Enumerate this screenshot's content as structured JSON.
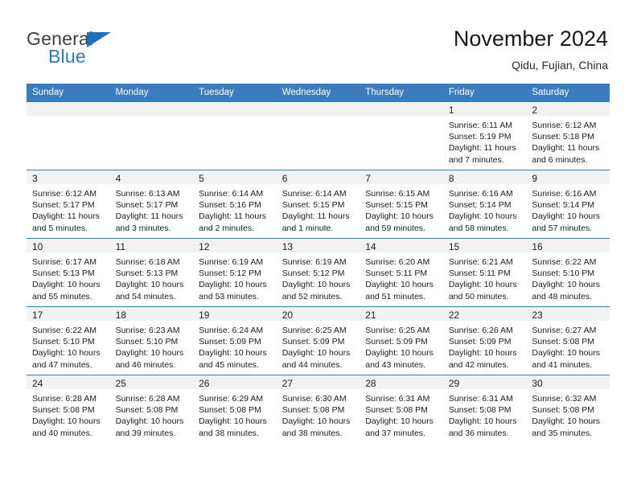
{
  "brand": {
    "name_part1": "General",
    "name_part2": "Blue",
    "logo_icon": "triangle-logo-icon"
  },
  "header": {
    "title": "November 2024",
    "subtitle": "Qidu, Fujian, China"
  },
  "calendar": {
    "accent_color": "#3a7cbe",
    "daynum_band_color": "#f2f2f2",
    "weekday_headers": [
      "Sunday",
      "Monday",
      "Tuesday",
      "Wednesday",
      "Thursday",
      "Friday",
      "Saturday"
    ],
    "labels": {
      "sunrise_prefix": "Sunrise:",
      "sunset_prefix": "Sunset:",
      "daylight_prefix": "Daylight:"
    },
    "weeks": [
      [
        {
          "day": "",
          "empty": true
        },
        {
          "day": "",
          "empty": true
        },
        {
          "day": "",
          "empty": true
        },
        {
          "day": "",
          "empty": true
        },
        {
          "day": "",
          "empty": true
        },
        {
          "day": "1",
          "sunrise": "Sunrise: 6:11 AM",
          "sunset": "Sunset: 5:19 PM",
          "daylight_line1": "Daylight: 11 hours",
          "daylight_line2": "and 7 minutes."
        },
        {
          "day": "2",
          "sunrise": "Sunrise: 6:12 AM",
          "sunset": "Sunset: 5:18 PM",
          "daylight_line1": "Daylight: 11 hours",
          "daylight_line2": "and 6 minutes."
        }
      ],
      [
        {
          "day": "3",
          "sunrise": "Sunrise: 6:12 AM",
          "sunset": "Sunset: 5:17 PM",
          "daylight_line1": "Daylight: 11 hours",
          "daylight_line2": "and 5 minutes."
        },
        {
          "day": "4",
          "sunrise": "Sunrise: 6:13 AM",
          "sunset": "Sunset: 5:17 PM",
          "daylight_line1": "Daylight: 11 hours",
          "daylight_line2": "and 3 minutes."
        },
        {
          "day": "5",
          "sunrise": "Sunrise: 6:14 AM",
          "sunset": "Sunset: 5:16 PM",
          "daylight_line1": "Daylight: 11 hours",
          "daylight_line2": "and 2 minutes."
        },
        {
          "day": "6",
          "sunrise": "Sunrise: 6:14 AM",
          "sunset": "Sunset: 5:15 PM",
          "daylight_line1": "Daylight: 11 hours",
          "daylight_line2": "and 1 minute."
        },
        {
          "day": "7",
          "sunrise": "Sunrise: 6:15 AM",
          "sunset": "Sunset: 5:15 PM",
          "daylight_line1": "Daylight: 10 hours",
          "daylight_line2": "and 59 minutes."
        },
        {
          "day": "8",
          "sunrise": "Sunrise: 6:16 AM",
          "sunset": "Sunset: 5:14 PM",
          "daylight_line1": "Daylight: 10 hours",
          "daylight_line2": "and 58 minutes."
        },
        {
          "day": "9",
          "sunrise": "Sunrise: 6:16 AM",
          "sunset": "Sunset: 5:14 PM",
          "daylight_line1": "Daylight: 10 hours",
          "daylight_line2": "and 57 minutes."
        }
      ],
      [
        {
          "day": "10",
          "sunrise": "Sunrise: 6:17 AM",
          "sunset": "Sunset: 5:13 PM",
          "daylight_line1": "Daylight: 10 hours",
          "daylight_line2": "and 55 minutes."
        },
        {
          "day": "11",
          "sunrise": "Sunrise: 6:18 AM",
          "sunset": "Sunset: 5:13 PM",
          "daylight_line1": "Daylight: 10 hours",
          "daylight_line2": "and 54 minutes."
        },
        {
          "day": "12",
          "sunrise": "Sunrise: 6:19 AM",
          "sunset": "Sunset: 5:12 PM",
          "daylight_line1": "Daylight: 10 hours",
          "daylight_line2": "and 53 minutes."
        },
        {
          "day": "13",
          "sunrise": "Sunrise: 6:19 AM",
          "sunset": "Sunset: 5:12 PM",
          "daylight_line1": "Daylight: 10 hours",
          "daylight_line2": "and 52 minutes."
        },
        {
          "day": "14",
          "sunrise": "Sunrise: 6:20 AM",
          "sunset": "Sunset: 5:11 PM",
          "daylight_line1": "Daylight: 10 hours",
          "daylight_line2": "and 51 minutes."
        },
        {
          "day": "15",
          "sunrise": "Sunrise: 6:21 AM",
          "sunset": "Sunset: 5:11 PM",
          "daylight_line1": "Daylight: 10 hours",
          "daylight_line2": "and 50 minutes."
        },
        {
          "day": "16",
          "sunrise": "Sunrise: 6:22 AM",
          "sunset": "Sunset: 5:10 PM",
          "daylight_line1": "Daylight: 10 hours",
          "daylight_line2": "and 48 minutes."
        }
      ],
      [
        {
          "day": "17",
          "sunrise": "Sunrise: 6:22 AM",
          "sunset": "Sunset: 5:10 PM",
          "daylight_line1": "Daylight: 10 hours",
          "daylight_line2": "and 47 minutes."
        },
        {
          "day": "18",
          "sunrise": "Sunrise: 6:23 AM",
          "sunset": "Sunset: 5:10 PM",
          "daylight_line1": "Daylight: 10 hours",
          "daylight_line2": "and 46 minutes."
        },
        {
          "day": "19",
          "sunrise": "Sunrise: 6:24 AM",
          "sunset": "Sunset: 5:09 PM",
          "daylight_line1": "Daylight: 10 hours",
          "daylight_line2": "and 45 minutes."
        },
        {
          "day": "20",
          "sunrise": "Sunrise: 6:25 AM",
          "sunset": "Sunset: 5:09 PM",
          "daylight_line1": "Daylight: 10 hours",
          "daylight_line2": "and 44 minutes."
        },
        {
          "day": "21",
          "sunrise": "Sunrise: 6:25 AM",
          "sunset": "Sunset: 5:09 PM",
          "daylight_line1": "Daylight: 10 hours",
          "daylight_line2": "and 43 minutes."
        },
        {
          "day": "22",
          "sunrise": "Sunrise: 6:26 AM",
          "sunset": "Sunset: 5:09 PM",
          "daylight_line1": "Daylight: 10 hours",
          "daylight_line2": "and 42 minutes."
        },
        {
          "day": "23",
          "sunrise": "Sunrise: 6:27 AM",
          "sunset": "Sunset: 5:08 PM",
          "daylight_line1": "Daylight: 10 hours",
          "daylight_line2": "and 41 minutes."
        }
      ],
      [
        {
          "day": "24",
          "sunrise": "Sunrise: 6:28 AM",
          "sunset": "Sunset: 5:08 PM",
          "daylight_line1": "Daylight: 10 hours",
          "daylight_line2": "and 40 minutes."
        },
        {
          "day": "25",
          "sunrise": "Sunrise: 6:28 AM",
          "sunset": "Sunset: 5:08 PM",
          "daylight_line1": "Daylight: 10 hours",
          "daylight_line2": "and 39 minutes."
        },
        {
          "day": "26",
          "sunrise": "Sunrise: 6:29 AM",
          "sunset": "Sunset: 5:08 PM",
          "daylight_line1": "Daylight: 10 hours",
          "daylight_line2": "and 38 minutes."
        },
        {
          "day": "27",
          "sunrise": "Sunrise: 6:30 AM",
          "sunset": "Sunset: 5:08 PM",
          "daylight_line1": "Daylight: 10 hours",
          "daylight_line2": "and 38 minutes."
        },
        {
          "day": "28",
          "sunrise": "Sunrise: 6:31 AM",
          "sunset": "Sunset: 5:08 PM",
          "daylight_line1": "Daylight: 10 hours",
          "daylight_line2": "and 37 minutes."
        },
        {
          "day": "29",
          "sunrise": "Sunrise: 6:31 AM",
          "sunset": "Sunset: 5:08 PM",
          "daylight_line1": "Daylight: 10 hours",
          "daylight_line2": "and 36 minutes."
        },
        {
          "day": "30",
          "sunrise": "Sunrise: 6:32 AM",
          "sunset": "Sunset: 5:08 PM",
          "daylight_line1": "Daylight: 10 hours",
          "daylight_line2": "and 35 minutes."
        }
      ]
    ]
  }
}
